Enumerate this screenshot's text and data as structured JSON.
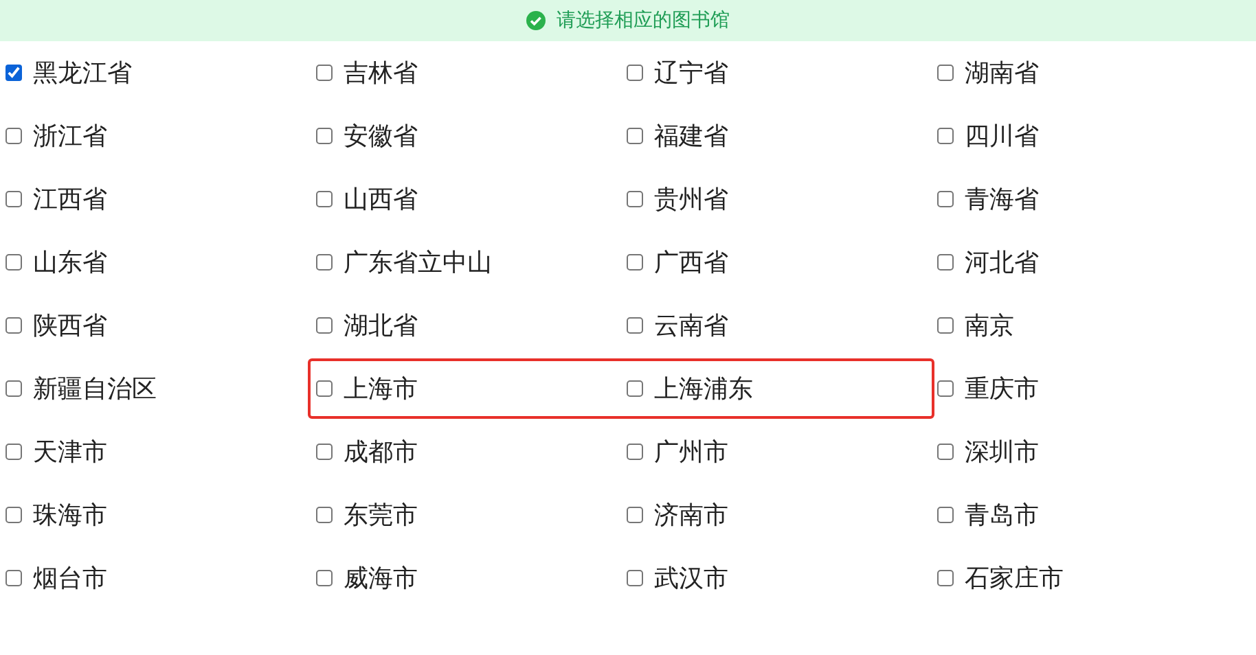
{
  "banner": {
    "text": "请选择相应的图书馆"
  },
  "rows": [
    [
      {
        "label": "黑龙江省",
        "checked": true,
        "highlighted": false
      },
      {
        "label": "吉林省",
        "checked": false,
        "highlighted": false
      },
      {
        "label": "辽宁省",
        "checked": false,
        "highlighted": false
      },
      {
        "label": "湖南省",
        "checked": false,
        "highlighted": false
      }
    ],
    [
      {
        "label": "浙江省",
        "checked": false,
        "highlighted": false
      },
      {
        "label": "安徽省",
        "checked": false,
        "highlighted": false
      },
      {
        "label": "福建省",
        "checked": false,
        "highlighted": false
      },
      {
        "label": "四川省",
        "checked": false,
        "highlighted": false
      }
    ],
    [
      {
        "label": "江西省",
        "checked": false,
        "highlighted": false
      },
      {
        "label": "山西省",
        "checked": false,
        "highlighted": false
      },
      {
        "label": "贵州省",
        "checked": false,
        "highlighted": false
      },
      {
        "label": "青海省",
        "checked": false,
        "highlighted": false
      }
    ],
    [
      {
        "label": "山东省",
        "checked": false,
        "highlighted": false
      },
      {
        "label": "广东省立中山",
        "checked": false,
        "highlighted": false
      },
      {
        "label": "广西省",
        "checked": false,
        "highlighted": false
      },
      {
        "label": "河北省",
        "checked": false,
        "highlighted": false
      }
    ],
    [
      {
        "label": "陕西省",
        "checked": false,
        "highlighted": false
      },
      {
        "label": "湖北省",
        "checked": false,
        "highlighted": false
      },
      {
        "label": "云南省",
        "checked": false,
        "highlighted": false
      },
      {
        "label": "南京",
        "checked": false,
        "highlighted": false
      }
    ],
    [
      {
        "label": "新疆自治区",
        "checked": false,
        "highlighted": false
      },
      {
        "label": "上海市",
        "checked": false,
        "highlighted": true
      },
      {
        "label": "上海浦东",
        "checked": false,
        "highlighted": true
      },
      {
        "label": "重庆市",
        "checked": false,
        "highlighted": false
      }
    ],
    [
      {
        "label": "天津市",
        "checked": false,
        "highlighted": false
      },
      {
        "label": "成都市",
        "checked": false,
        "highlighted": false
      },
      {
        "label": "广州市",
        "checked": false,
        "highlighted": false
      },
      {
        "label": "深圳市",
        "checked": false,
        "highlighted": false
      }
    ],
    [
      {
        "label": "珠海市",
        "checked": false,
        "highlighted": false
      },
      {
        "label": "东莞市",
        "checked": false,
        "highlighted": false
      },
      {
        "label": "济南市",
        "checked": false,
        "highlighted": false
      },
      {
        "label": "青岛市",
        "checked": false,
        "highlighted": false
      }
    ],
    [
      {
        "label": "烟台市",
        "checked": false,
        "highlighted": false
      },
      {
        "label": "威海市",
        "checked": false,
        "highlighted": false
      },
      {
        "label": "武汉市",
        "checked": false,
        "highlighted": false
      },
      {
        "label": "石家庄市",
        "checked": false,
        "highlighted": false
      }
    ]
  ]
}
